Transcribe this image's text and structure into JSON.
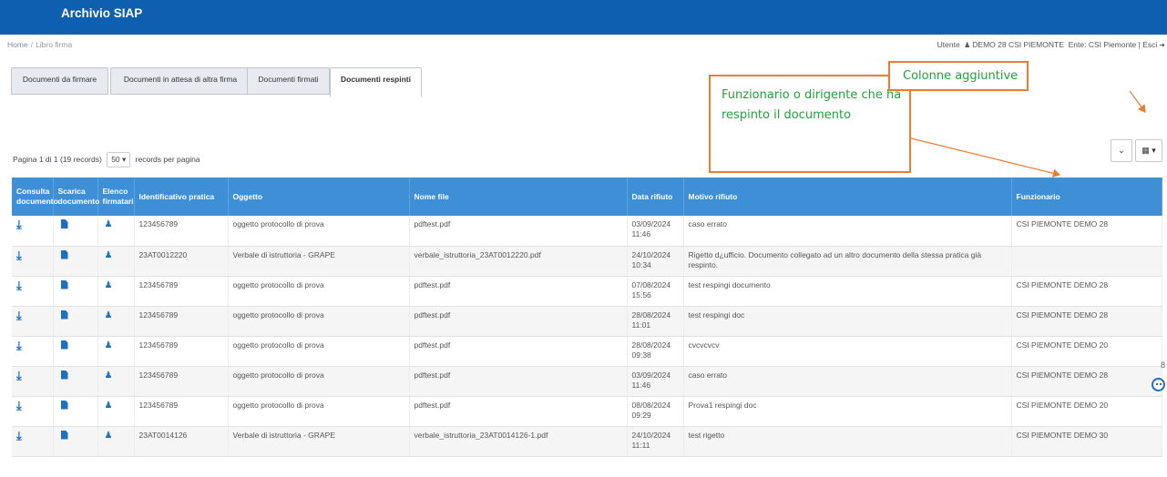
{
  "header": {
    "app_title": "Archivio SIAP",
    "color": "#0e5fb0"
  },
  "breadcrumb": {
    "home": "Home",
    "separator": "/",
    "current": "Libro firma"
  },
  "user_info": {
    "utente_label": "Utente",
    "user_icon": "user-icon",
    "user_name": "DEMO 28 CSI PIEMONTE",
    "ente": "Ente: CSI Piemonte",
    "separator": "|",
    "logout": "Esci",
    "logout_icon": "exit-icon"
  },
  "tabs": [
    {
      "label": "Documenti da firmare"
    },
    {
      "label": "Documenti in attesa di altra firma"
    },
    {
      "label": "Documenti firmati"
    },
    {
      "label": "Documenti respinti",
      "active": true
    }
  ],
  "annotations": {
    "funzionario": "Funzionario o dirigente che ha respinto il documento",
    "colonne": "Colonne aggiuntive",
    "border_color": "#ec7c30",
    "text_color": "#1fa23a"
  },
  "toolbar": {
    "caret_icon": "chevron-down-icon",
    "caret": "⌄",
    "columns_icon": "columns-icon",
    "columns": "▦ ▾"
  },
  "pager": {
    "info": "Pagina 1 di 1 (19 records)",
    "per_page": "50 ▾",
    "suffix": "records per pagina"
  },
  "table": {
    "headers": [
      "Consulta documento",
      "Scarica documento",
      "Elenco firmatari",
      "Identificativo pratica",
      "Oggetto",
      "Nome file",
      "Data rifiuto",
      "Motivo rifiuto",
      "Funzionario"
    ],
    "header_color": "#3e8fd6",
    "rows": [
      {
        "id": "123456789",
        "oggetto": "oggetto protocollo di prova",
        "file": "pdftest.pdf",
        "data": "03/09/2024 11:46",
        "motivo": "caso errato",
        "funzionario": "CSI PIEMONTE DEMO 28"
      },
      {
        "id": "23AT0012220",
        "oggetto": "Verbale di istruttoria - GRAPE",
        "file": "verbale_istruttoria_23AT0012220.pdf",
        "data": "24/10/2024 10:34",
        "motivo": "Rigetto d¿ufficio. Documento collegato ad un altro documento della stessa pratica già respinto.",
        "funzionario": ""
      },
      {
        "id": "123456789",
        "oggetto": "oggetto protocollo di prova",
        "file": "pdftest.pdf",
        "data": "07/08/2024 15:56",
        "motivo": "test respingi documento",
        "funzionario": "CSI PIEMONTE DEMO 28"
      },
      {
        "id": "123456789",
        "oggetto": "oggetto protocollo di prova",
        "file": "pdftest.pdf",
        "data": "28/08/2024 11:01",
        "motivo": "test respingi doc",
        "funzionario": "CSI PIEMONTE DEMO 28"
      },
      {
        "id": "123456789",
        "oggetto": "oggetto protocollo di prova",
        "file": "pdftest.pdf",
        "data": "28/08/2024 09:38",
        "motivo": "cvcvcvcv",
        "funzionario": "CSI PIEMONTE DEMO 20"
      },
      {
        "id": "123456789",
        "oggetto": "oggetto protocollo di prova",
        "file": "pdftest.pdf",
        "data": "03/09/2024 11:46",
        "motivo": "caso errato",
        "funzionario": "CSI PIEMONTE DEMO 28"
      },
      {
        "id": "123456789",
        "oggetto": "oggetto protocollo di prova",
        "file": "pdftest.pdf",
        "data": "08/08/2024 09:29",
        "motivo": "Prova1 respingi doc",
        "funzionario": "CSI PIEMONTE DEMO 20"
      },
      {
        "id": "23AT0014126",
        "oggetto": "Verbale di istruttoria - GRAPE",
        "file": "verbale_istruttoria_23AT0014126-1.pdf",
        "data": "24/10/2024 11:11",
        "motivo": "test rigetto",
        "funzionario": "CSI PIEMONTE DEMO 30"
      }
    ],
    "row_icons": {
      "consulta": "download-icon",
      "scarica": "file-icon",
      "firmatari": "user-icon"
    }
  },
  "side_widget": {
    "number": "8",
    "icon": "chat-bot-icon"
  }
}
